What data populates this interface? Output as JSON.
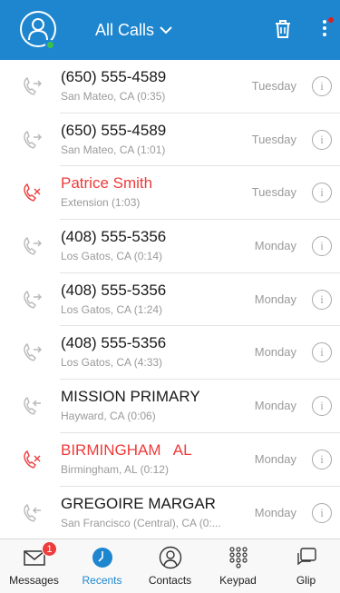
{
  "header": {
    "title": "All Calls",
    "presence_color": "#3cc04d",
    "background": "#1e86cf"
  },
  "calls": [
    {
      "name": "(650) 555-4589",
      "detail": "San Mateo, CA (0:35)",
      "day": "Tuesday",
      "direction": "outgoing",
      "missed": false
    },
    {
      "name": "(650) 555-4589",
      "detail": "San Mateo, CA (1:01)",
      "day": "Tuesday",
      "direction": "outgoing",
      "missed": false
    },
    {
      "name": "Patrice Smith",
      "detail": "Extension (1:03)",
      "day": "Tuesday",
      "direction": "missed",
      "missed": true
    },
    {
      "name": "(408) 555-5356",
      "detail": "Los Gatos, CA (0:14)",
      "day": "Monday",
      "direction": "outgoing",
      "missed": false
    },
    {
      "name": "(408) 555-5356",
      "detail": "Los Gatos, CA (1:24)",
      "day": "Monday",
      "direction": "outgoing",
      "missed": false
    },
    {
      "name": "(408) 555-5356",
      "detail": "Los Gatos, CA (4:33)",
      "day": "Monday",
      "direction": "outgoing",
      "missed": false
    },
    {
      "name": "MISSION PRIMARY",
      "detail": "Hayward, CA (0:06)",
      "day": "Monday",
      "direction": "incoming",
      "missed": false
    },
    {
      "name": "BIRMINGHAM   AL",
      "detail": "Birmingham, AL (0:12)",
      "day": "Monday",
      "direction": "missed",
      "missed": true
    },
    {
      "name": "GREGOIRE MARGAR",
      "detail": "San Francisco (Central), CA (0:...",
      "day": "Monday",
      "direction": "incoming",
      "missed": false
    }
  ],
  "tabs": [
    {
      "label": "Messages",
      "icon": "envelope-icon",
      "badge": "1",
      "active": false
    },
    {
      "label": "Recents",
      "icon": "clock-icon",
      "active": true
    },
    {
      "label": "Contacts",
      "icon": "person-icon",
      "active": false
    },
    {
      "label": "Keypad",
      "icon": "keypad-icon",
      "active": false
    },
    {
      "label": "Glip",
      "icon": "chat-icon",
      "active": false
    }
  ],
  "colors": {
    "accent": "#1e86cf",
    "missed": "#ee3b3b"
  }
}
